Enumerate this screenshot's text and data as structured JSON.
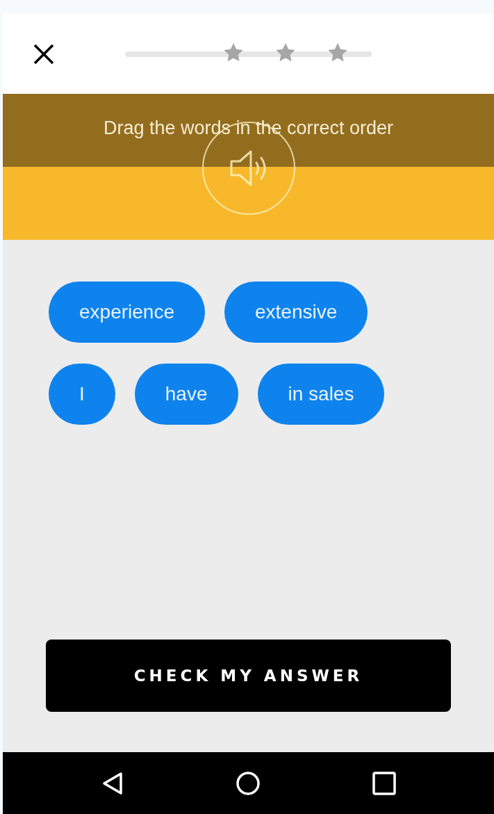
{
  "prompt": {
    "instruction": "Drag the words in the correct order"
  },
  "words": [
    {
      "text": "experience"
    },
    {
      "text": "extensive"
    },
    {
      "text": "I"
    },
    {
      "text": "have"
    },
    {
      "text": "in sales"
    }
  ],
  "check_button": {
    "label": "CHECK MY ANSWER"
  }
}
